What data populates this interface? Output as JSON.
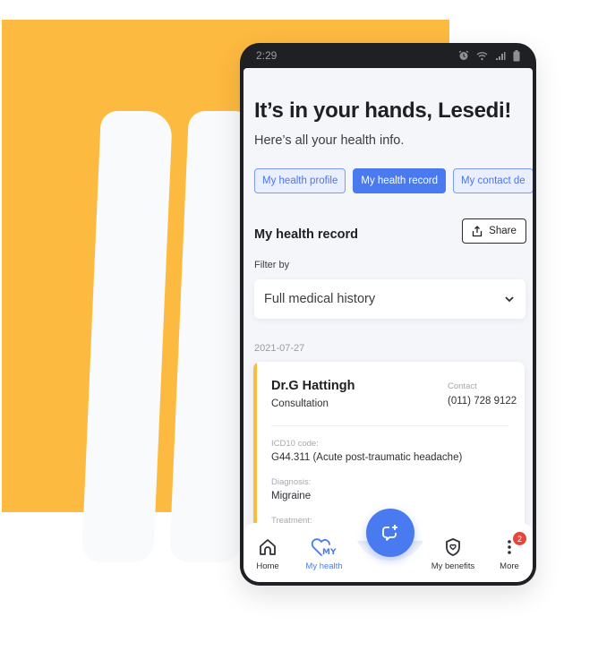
{
  "colors": {
    "background_accent": "#FDBA40",
    "primary_blue": "#4a7af0",
    "badge_red": "#e5473b",
    "text_dark": "#1e1f22"
  },
  "status_bar": {
    "time": "2:29",
    "icons": [
      "alarm-icon",
      "wifi-icon",
      "signal-icon",
      "battery-icon"
    ]
  },
  "header": {
    "greeting": "It’s in your hands, Lesedi!",
    "subtitle": "Here’s all your health info."
  },
  "tabs": [
    {
      "label": "My health profile",
      "active": false
    },
    {
      "label": "My health record",
      "active": true
    },
    {
      "label": "My contact de",
      "active": false
    }
  ],
  "section": {
    "title": "My health record",
    "share_label": "Share"
  },
  "filter": {
    "label": "Filter by",
    "selected": "Full medical history"
  },
  "records": [
    {
      "date": "2021-07-27",
      "doctor": "Dr.G Hattingh",
      "type": "Consultation",
      "contact_label": "Contact",
      "contact_value": "(011) 728 9122",
      "icd_label": "ICD10 code:",
      "icd_value": "G44.311 (Acute post-traumatic headache)",
      "diagnosis_label": "Diagnosis:",
      "diagnosis_value": "Migraine",
      "treatment_label": "Treatment:"
    }
  ],
  "bottom_nav": {
    "items": [
      {
        "label": "Home",
        "icon": "home-icon"
      },
      {
        "label": "My health",
        "icon": "my-health-heart-icon",
        "active": true
      },
      {
        "label": "My benefits",
        "icon": "shield-icon"
      },
      {
        "label": "More",
        "icon": "more-vertical-icon"
      }
    ],
    "fab_icon": "chat-plus-icon",
    "more_badge": "2"
  }
}
